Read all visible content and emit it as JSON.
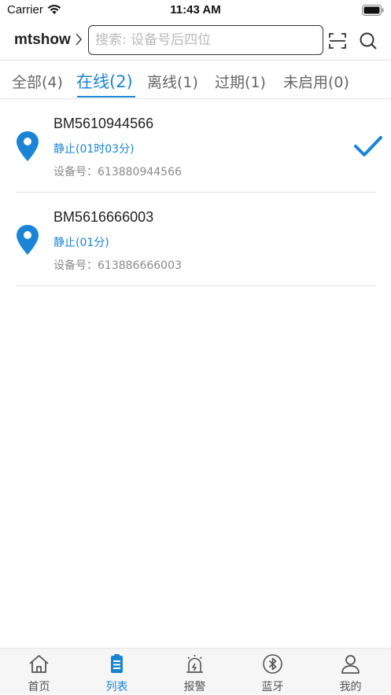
{
  "status_bar": {
    "carrier": "Carrier",
    "time": "11:43 AM"
  },
  "nav": {
    "account": "mtshow",
    "search_placeholder": "搜索: 设备号后四位"
  },
  "tabs": [
    {
      "label": "全部(4)"
    },
    {
      "label": "在线(2)"
    },
    {
      "label": "离线(1)"
    },
    {
      "label": "过期(1)"
    },
    {
      "label": "未启用(0)"
    }
  ],
  "devices": [
    {
      "name": "BM5610944566",
      "status": "静止(01时03分)",
      "imei": "设备号：613880944566",
      "selected": true
    },
    {
      "name": "BM5616666003",
      "status": "静止(01分)",
      "imei": "设备号：613886666003",
      "selected": false
    }
  ],
  "tabbar": [
    {
      "label": "首页",
      "icon": "home-icon"
    },
    {
      "label": "列表",
      "icon": "list-icon"
    },
    {
      "label": "报警",
      "icon": "alarm-icon"
    },
    {
      "label": "蓝牙",
      "icon": "bluetooth-icon"
    },
    {
      "label": "我的",
      "icon": "profile-icon"
    }
  ],
  "colors": {
    "accent": "#1a84d6",
    "text": "#222222",
    "muted": "#8a8a8a",
    "tabbar_bg": "#f6f6f6"
  }
}
